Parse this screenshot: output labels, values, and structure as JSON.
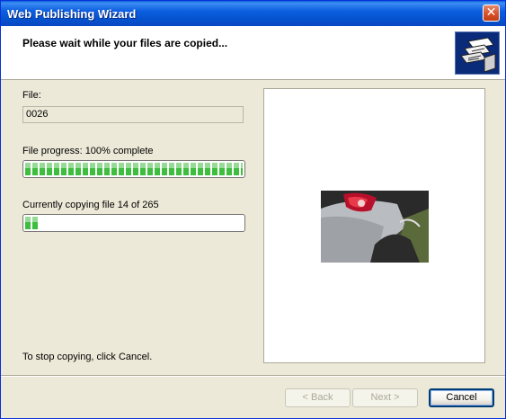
{
  "window": {
    "title": "Web Publishing Wizard"
  },
  "header": {
    "title": "Please wait while your files are copied..."
  },
  "file": {
    "label": "File:",
    "value": "0026"
  },
  "file_progress": {
    "label": "File progress: 100% complete",
    "percent": 100
  },
  "overall_progress": {
    "label": "Currently copying file 14 of 265",
    "current": 14,
    "total": 265
  },
  "hint": "To stop copying, click Cancel.",
  "buttons": {
    "back": "< Back",
    "next": "Next >",
    "cancel": "Cancel"
  },
  "colors": {
    "titlebar": "#0a5fd8",
    "progress": "#3ebd3e",
    "panel": "#ece9d8"
  }
}
